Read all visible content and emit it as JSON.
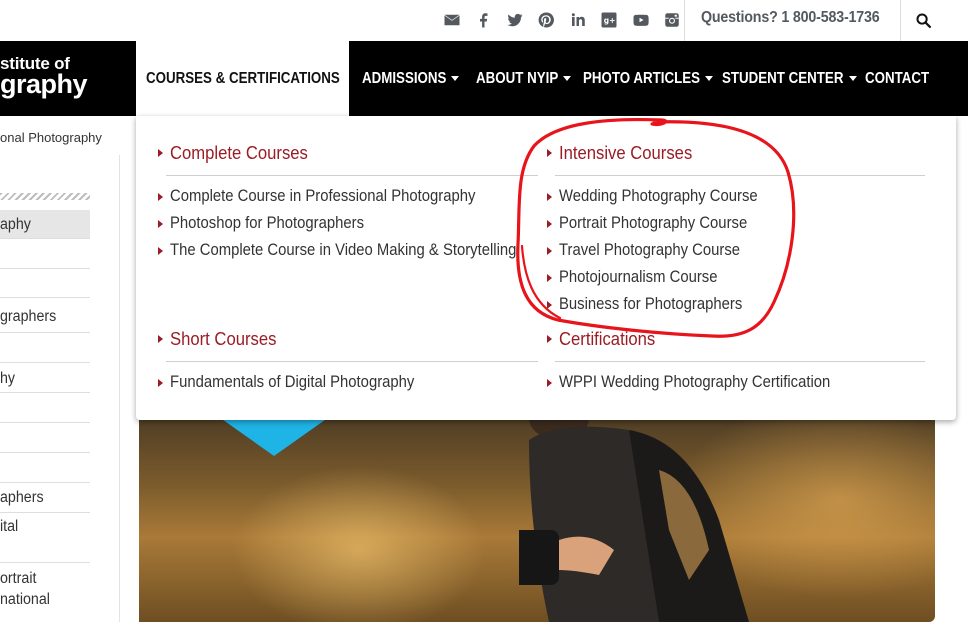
{
  "topbar": {
    "social_icons": [
      "email-icon",
      "facebook-icon",
      "twitter-icon",
      "pinterest-icon",
      "linkedin-icon",
      "google-plus-icon",
      "youtube-icon",
      "instagram-icon"
    ],
    "phone": "Questions? 1 800-583-1736",
    "search_icon": "search-icon"
  },
  "brand": {
    "logo_line1": "stitute of",
    "logo_line2": "graphy",
    "subtitle": "onal Photography"
  },
  "nav": {
    "active": "COURSES & CERTIFICATIONS",
    "items": [
      {
        "label": "ADMISSIONS",
        "has_caret": true
      },
      {
        "label": "ABOUT NYIP",
        "has_caret": true
      },
      {
        "label": "PHOTO ARTICLES",
        "has_caret": true
      },
      {
        "label": "STUDENT CENTER",
        "has_caret": true
      },
      {
        "label": "CONTACT",
        "has_caret": false
      }
    ]
  },
  "dropdown": {
    "complete": {
      "heading": "Complete Courses",
      "links": [
        "Complete Course in Professional Photography",
        "Photoshop for Photographers",
        "The Complete Course in Video Making & Storytelling"
      ]
    },
    "intensive": {
      "heading": "Intensive Courses",
      "links": [
        "Wedding Photography Course",
        "Portrait Photography Course",
        "Travel Photography Course",
        "Photojournalism Course",
        "Business for Photographers"
      ]
    },
    "short": {
      "heading": "Short Courses",
      "links": [
        "Fundamentals of Digital Photography"
      ]
    },
    "certifications": {
      "heading": "Certifications",
      "links": [
        "WPPI Wedding Photography Certification"
      ]
    }
  },
  "sidebar": {
    "items": [
      "aphy",
      "",
      "graphers",
      "",
      "hy",
      "",
      "",
      "aphers",
      "ital",
      "",
      "ortrait",
      "national"
    ]
  },
  "colors": {
    "accent": "#9a1c25",
    "nav_bg": "#000000",
    "annotation": "#e8141b"
  }
}
